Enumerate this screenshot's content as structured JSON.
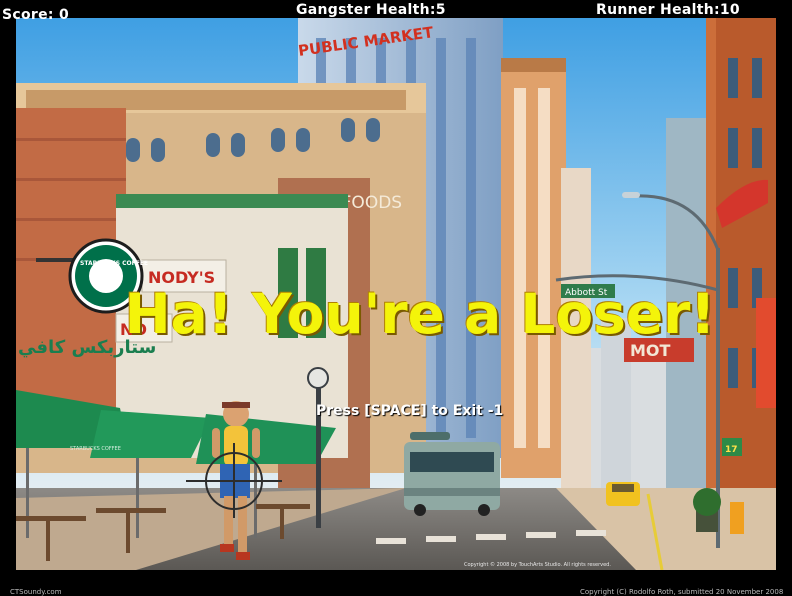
{
  "hud": {
    "score_text": "Score: 0",
    "gangster_health_text": "Gangster Health:5",
    "runner_health_text": "Runner Health:10"
  },
  "game": {
    "result_message": "Ha! You're a Loser!",
    "exit_instruction": "Press [SPACE] to Exit -1",
    "result_color": "#f4f40a"
  },
  "scene": {
    "market_sign": "PUBLIC MARKET",
    "fine_foods_sign": "FINE FOODS",
    "nodys_sign": "NODY'S",
    "no_sign": "NO",
    "street_sign": "Abbott St",
    "hotel_sign": "MOT",
    "starbucks_sign": "STARBUCKS COFFEE",
    "arabic_sign": "ستاربكس كافي",
    "awning_text": "STARBUCKS COFFEE",
    "bus_number": "17",
    "scene_copyright": "Copyright © 2008 by TouchArts Studio. All rights reserved."
  },
  "footer": {
    "left_text": "CTSoundy.com",
    "right_text": "Copyright (C) Rodolfo Roth, submitted 20 November 2008"
  }
}
